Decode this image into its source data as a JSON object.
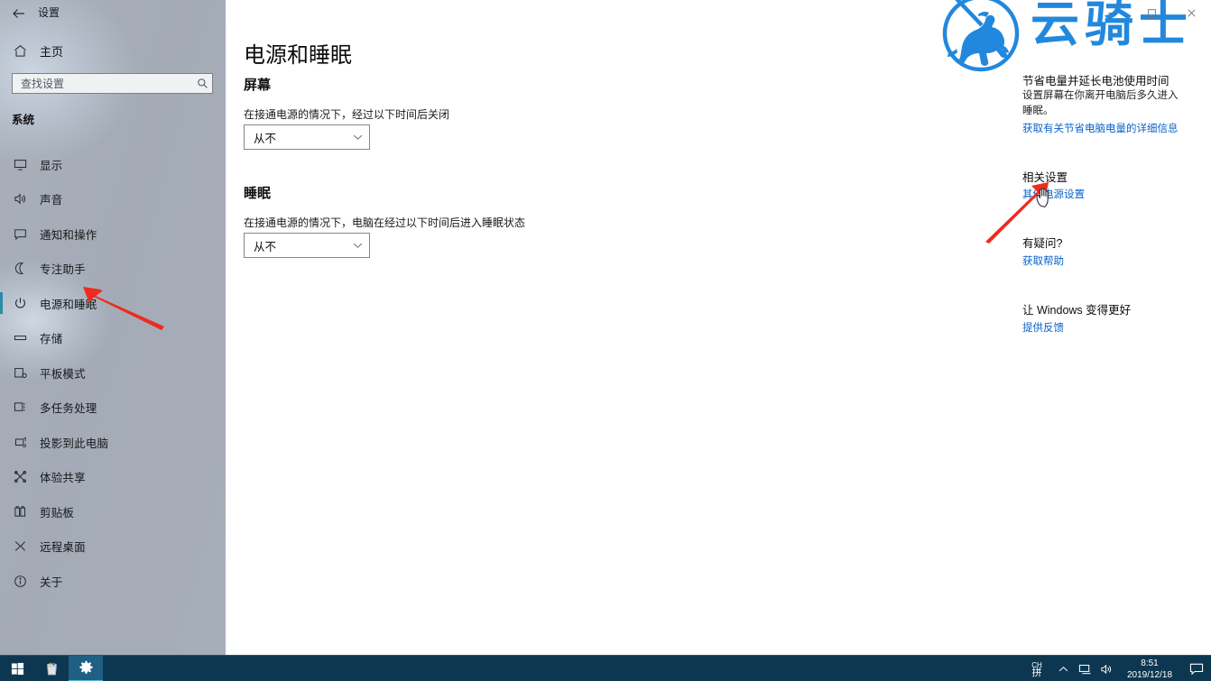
{
  "window": {
    "title": "设置",
    "back_icon": "back-arrow-icon",
    "controls": {
      "minimize": "—",
      "maximize": "❐",
      "close": "✕"
    }
  },
  "sidebar": {
    "home_label": "主页",
    "home_icon": "home-icon",
    "search": {
      "placeholder": "查找设置",
      "icon": "search-icon"
    },
    "group_label": "系统",
    "items": [
      {
        "label": "显示",
        "icon": "monitor-icon",
        "selected": false
      },
      {
        "label": "声音",
        "icon": "speaker-icon",
        "selected": false
      },
      {
        "label": "通知和操作",
        "icon": "notification-icon",
        "selected": false
      },
      {
        "label": "专注助手",
        "icon": "moon-icon",
        "selected": false
      },
      {
        "label": "电源和睡眠",
        "icon": "power-icon",
        "selected": true
      },
      {
        "label": "存储",
        "icon": "storage-icon",
        "selected": false
      },
      {
        "label": "平板模式",
        "icon": "tablet-icon",
        "selected": false
      },
      {
        "label": "多任务处理",
        "icon": "multitask-icon",
        "selected": false
      },
      {
        "label": "投影到此电脑",
        "icon": "project-icon",
        "selected": false
      },
      {
        "label": "体验共享",
        "icon": "share-icon",
        "selected": false
      },
      {
        "label": "剪贴板",
        "icon": "clipboard-icon",
        "selected": false
      },
      {
        "label": "远程桌面",
        "icon": "remote-desktop-icon",
        "selected": false
      },
      {
        "label": "关于",
        "icon": "info-icon",
        "selected": false
      }
    ]
  },
  "main": {
    "page_title": "电源和睡眠",
    "screen": {
      "heading": "屏幕",
      "description": "在接通电源的情况下，经过以下时间后关闭",
      "dropdown_value": "从不",
      "dropdown_icon": "chevron-down-icon"
    },
    "sleep": {
      "heading": "睡眠",
      "description": "在接通电源的情况下，电脑在经过以下时间后进入睡眠状态",
      "dropdown_value": "从不",
      "dropdown_icon": "chevron-down-icon"
    }
  },
  "rail": {
    "promo_title": "节省电量并延长电池使用时间",
    "promo_desc": "设置屏幕在你离开电脑后多久进入睡眠。",
    "promo_link": "获取有关节省电脑电量的详细信息",
    "related_title": "相关设置",
    "related_link": "其他电源设置",
    "question_title": "有疑问?",
    "question_link": "获取帮助",
    "feedback_title": "让 Windows 变得更好",
    "feedback_link": "提供反馈"
  },
  "watermark": {
    "text": "云骑士",
    "logo_icon": "knight-emblem-icon",
    "color": "#2288dd"
  },
  "annotations": {
    "arrow_sidebar": "red-arrow-pointing-to-power-and-sleep",
    "arrow_rail": "red-arrow-pointing-to-other-power-settings",
    "cursor": "hand-cursor"
  },
  "taskbar": {
    "start_icon": "windows-start-icon",
    "apps": [
      {
        "icon": "recycle-bin-icon",
        "active": false
      },
      {
        "icon": "settings-gear-icon",
        "active": true
      }
    ],
    "tray": {
      "ime_top": "CH",
      "ime_bottom": "拼",
      "chevron_icon": "chevron-up-icon",
      "network_icon": "network-icon",
      "volume_icon": "volume-icon",
      "time": "8:51",
      "date": "2019/12/18",
      "action_center_icon": "action-center-icon"
    }
  },
  "colors": {
    "accent": "#2a8ca8",
    "link": "#0a63c9",
    "sidebar_bg": "#a6adb8",
    "taskbar_bg": "#0d3750",
    "annotation_red": "#ee2b20"
  }
}
